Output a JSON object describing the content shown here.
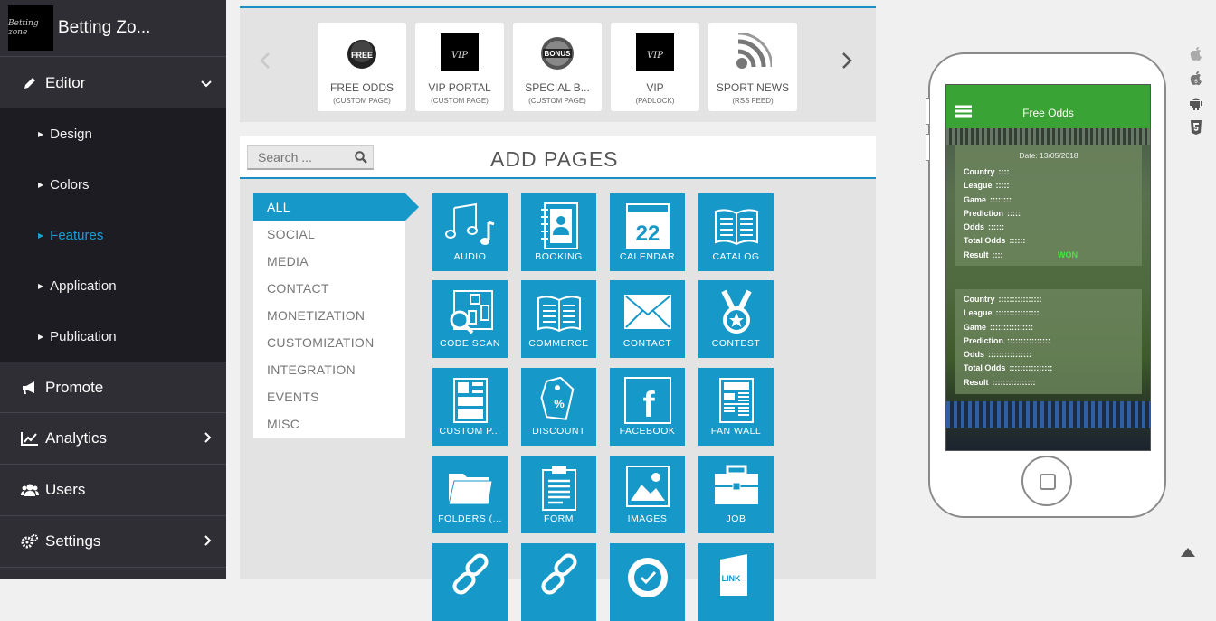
{
  "sidebar": {
    "logo_text": "Betting zone",
    "app_name": "Betting Zo...",
    "editor_label": "Editor",
    "editor_sub": [
      "Design",
      "Colors",
      "Features",
      "Application",
      "Publication"
    ],
    "promote_label": "Promote",
    "analytics_label": "Analytics",
    "users_label": "Users",
    "settings_label": "Settings"
  },
  "carousel": {
    "items": [
      {
        "title": "FREE ODDS",
        "subtitle": "(CUSTOM PAGE)",
        "thumb_text": "FREE"
      },
      {
        "title": "VIP PORTAL",
        "subtitle": "(CUSTOM PAGE)",
        "thumb_text": "VIP"
      },
      {
        "title": "SPECIAL B...",
        "subtitle": "(CUSTOM PAGE)",
        "thumb_text": "BONUS"
      },
      {
        "title": "VIP",
        "subtitle": "(PADLOCK)",
        "thumb_text": "VIP"
      },
      {
        "title": "SPORT NEWS",
        "subtitle": "(RSS FEED)",
        "thumb_text": ""
      }
    ]
  },
  "add_pages": {
    "search_placeholder": "Search ...",
    "title": "ADD PAGES",
    "categories": [
      "ALL",
      "SOCIAL",
      "MEDIA",
      "CONTACT",
      "MONETIZATION",
      "CUSTOMIZATION",
      "INTEGRATION",
      "EVENTS",
      "MISC"
    ],
    "tiles": [
      {
        "label": "AUDIO",
        "icon": "music-icon"
      },
      {
        "label": "BOOKING",
        "icon": "address-book-icon"
      },
      {
        "label": "CALENDAR",
        "icon": "calendar-icon",
        "day": "22"
      },
      {
        "label": "CATALOG",
        "icon": "open-book-icon"
      },
      {
        "label": "CODE SCAN",
        "icon": "qr-scan-icon"
      },
      {
        "label": "COMMERCE",
        "icon": "open-book-icon"
      },
      {
        "label": "CONTACT",
        "icon": "envelope-icon"
      },
      {
        "label": "CONTEST",
        "icon": "medal-icon"
      },
      {
        "label": "CUSTOM P...",
        "icon": "layout-icon"
      },
      {
        "label": "DISCOUNT",
        "icon": "price-tag-icon"
      },
      {
        "label": "FACEBOOK",
        "icon": "facebook-icon"
      },
      {
        "label": "FAN WALL",
        "icon": "newspaper-icon"
      },
      {
        "label": "FOLDERS (...",
        "icon": "folder-icon"
      },
      {
        "label": "FORM",
        "icon": "clipboard-icon"
      },
      {
        "label": "IMAGES",
        "icon": "image-icon"
      },
      {
        "label": "JOB",
        "icon": "briefcase-icon"
      },
      {
        "label": "",
        "icon": "link-icon"
      },
      {
        "label": "",
        "icon": "link-icon"
      },
      {
        "label": "",
        "icon": "badge-check-icon"
      },
      {
        "label": "",
        "icon": "link-page-icon",
        "text": "LINK"
      }
    ]
  },
  "phone": {
    "app_title": "Free Odds",
    "date": "Date: 13/05/2018",
    "card1": [
      {
        "key": "Country",
        "val": "::::"
      },
      {
        "key": "League",
        "val": ":::::"
      },
      {
        "key": "Game",
        "val": "::::::::"
      },
      {
        "key": "Prediction",
        "val": ":::::"
      },
      {
        "key": "Odds",
        "val": "::::::"
      },
      {
        "key": "Total Odds",
        "val": "::::::"
      },
      {
        "key": "Result",
        "val": "::::"
      }
    ],
    "result_status": "WON",
    "card2": [
      {
        "key": "Country",
        "val": "::::::::::::::::"
      },
      {
        "key": "League",
        "val": "::::::::::::::::"
      },
      {
        "key": "Game",
        "val": "::::::::::::::::"
      },
      {
        "key": "Prediction",
        "val": "::::::::::::::::"
      },
      {
        "key": "Odds",
        "val": "::::::::::::::::"
      },
      {
        "key": "Total Odds",
        "val": "::::::::::::::::"
      },
      {
        "key": "Result",
        "val": "::::::::::::::::"
      }
    ],
    "os_icons": [
      "apple-icon",
      "ios6-icon",
      "android-icon",
      "html5-icon"
    ]
  },
  "colors": {
    "accent": "#1698c9",
    "sidebar_bg": "#2e2e34",
    "app_green": "#3aa335"
  }
}
